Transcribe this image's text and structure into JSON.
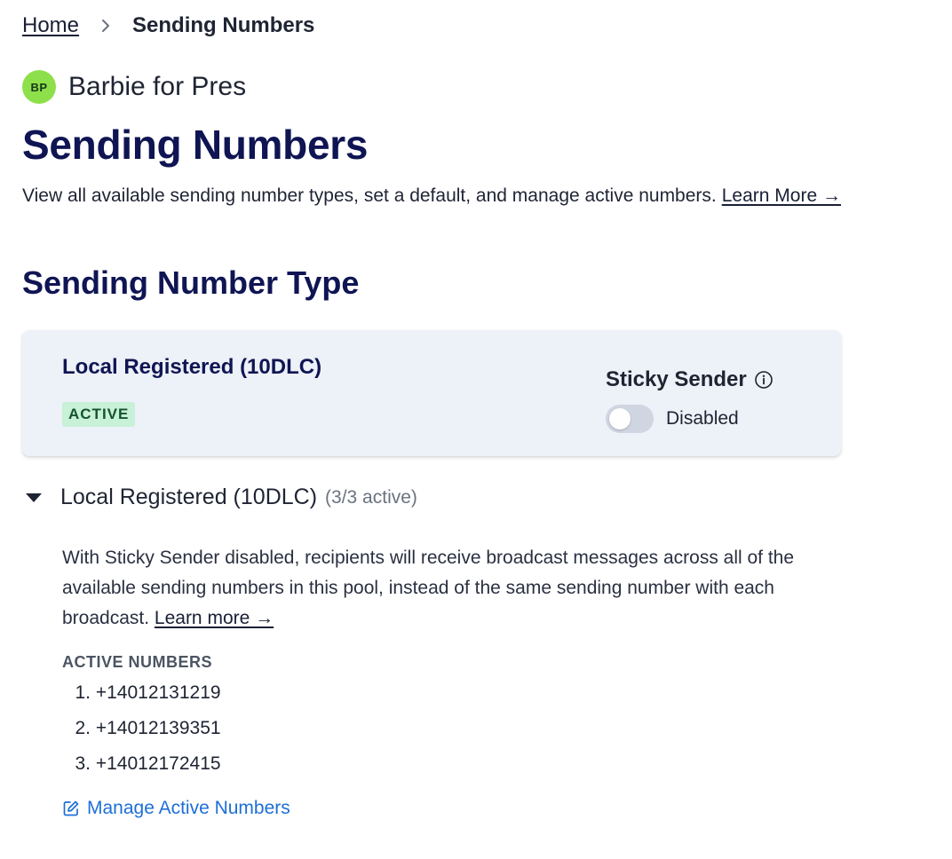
{
  "breadcrumb": {
    "home_label": "Home",
    "separator": "›",
    "current_label": "Sending Numbers"
  },
  "org": {
    "initials": "BP",
    "name": "Barbie for Pres",
    "avatar_color": "#8ee04a"
  },
  "page": {
    "title": "Sending Numbers",
    "description": "View all available sending number types, set a default, and manage active numbers.",
    "learn_more_label": "Learn More →"
  },
  "section": {
    "title": "Sending Number Type"
  },
  "card": {
    "title": "Local Registered (10DLC)",
    "badge": "ACTIVE",
    "sticky_sender_label": "Sticky Sender",
    "info_icon": "info-circle-icon",
    "toggle_label": "Disabled",
    "toggle_on": false
  },
  "accordion": {
    "title": "Local Registered (10DLC)",
    "count": "(3/3 active)",
    "expanded": true,
    "description": "With Sticky Sender disabled, recipients will receive broadcast messages across all of the available sending numbers in this pool, instead of the same sending number with each broadcast.",
    "learn_more_label": "Learn more →",
    "active_numbers_heading": "ACTIVE NUMBERS",
    "numbers": [
      {
        "index": "1.",
        "value": "+14012131219"
      },
      {
        "index": "2.",
        "value": "+14012139351"
      },
      {
        "index": "3.",
        "value": "+14012172415"
      }
    ],
    "manage_label": "Manage Active Numbers",
    "manage_icon": "edit-icon"
  },
  "colors": {
    "heading": "#0f1553",
    "link_blue": "#1d6fd6",
    "card_bg": "#edf1f8",
    "badge_bg": "#c8f1d7",
    "badge_text": "#14532d"
  }
}
